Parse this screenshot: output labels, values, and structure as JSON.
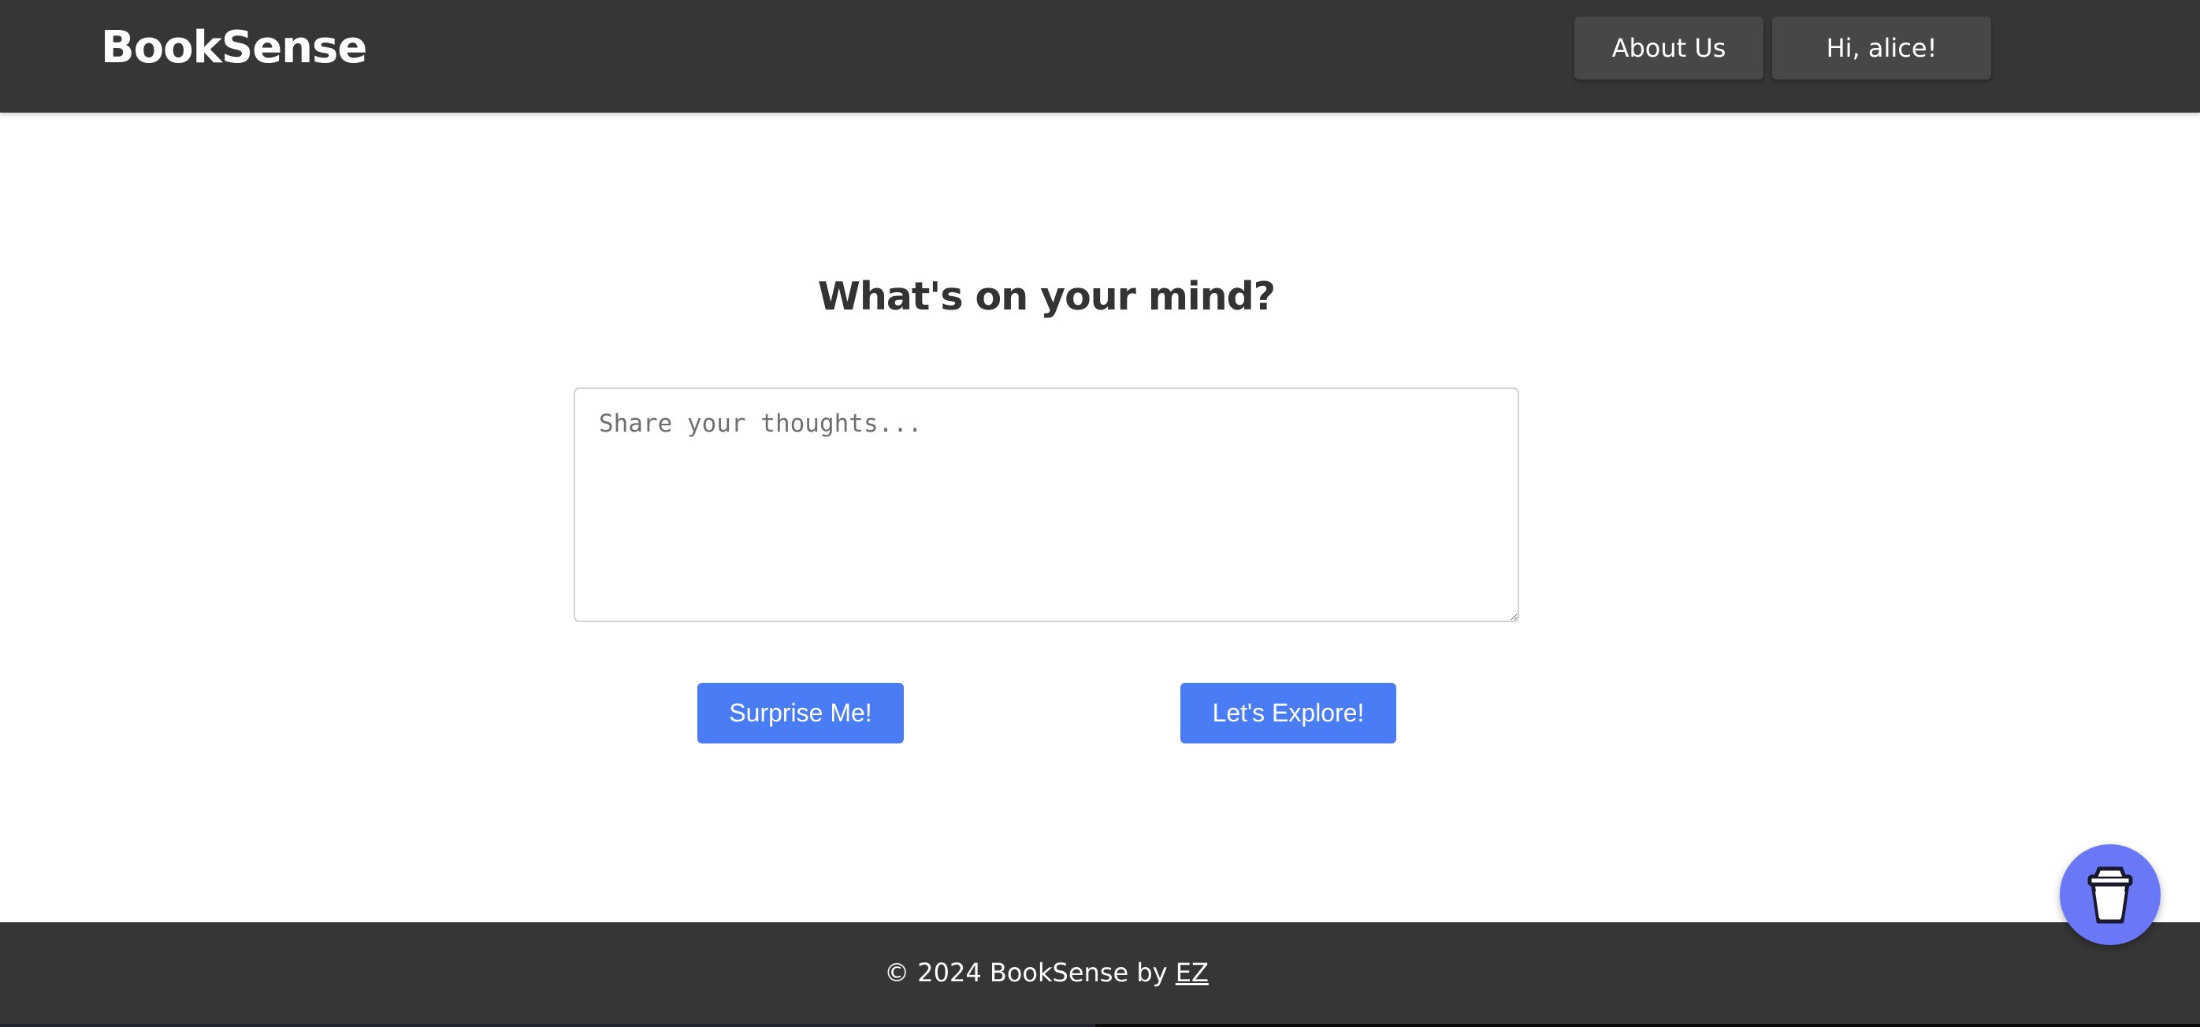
{
  "header": {
    "brand": "BookSense",
    "about_label": "About Us",
    "user_label": "Hi, alice!"
  },
  "main": {
    "heading": "What's on your mind?",
    "textarea_placeholder": "Share your thoughts...",
    "surprise_label": "Surprise Me!",
    "explore_label": "Let's Explore!"
  },
  "footer": {
    "text": "© 2024 BookSense by ",
    "author_link": "EZ"
  },
  "floating": {
    "icon": "coffee-cup-icon"
  },
  "colors": {
    "nav_background": "#363636",
    "nav_button": "#474747",
    "primary_button": "#4a7cf6",
    "heading_text": "#333333",
    "floating_button": "#6a78f8"
  }
}
